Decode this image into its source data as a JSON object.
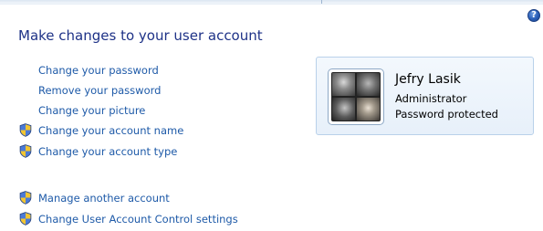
{
  "page_title": "Make changes to your user account",
  "help_icon": {
    "glyph": "?",
    "icon": "help-icon"
  },
  "tasks": [
    {
      "label": "Change your password",
      "shield": false
    },
    {
      "label": "Remove your password",
      "shield": false
    },
    {
      "label": "Change your picture",
      "shield": false
    },
    {
      "label": "Change your account name",
      "shield": true
    },
    {
      "label": "Change your account type",
      "shield": true
    }
  ],
  "other_tasks": [
    {
      "label": "Manage another account",
      "shield": true
    },
    {
      "label": "Change User Account Control settings",
      "shield": true
    }
  ],
  "user": {
    "name": "Jefry Lasik",
    "role": "Administrator",
    "status": "Password protected"
  },
  "colors": {
    "link": "#1e5aa8",
    "title": "#1e3287",
    "card_border": "#b9d1ea",
    "card_background": "#eef5fc"
  }
}
